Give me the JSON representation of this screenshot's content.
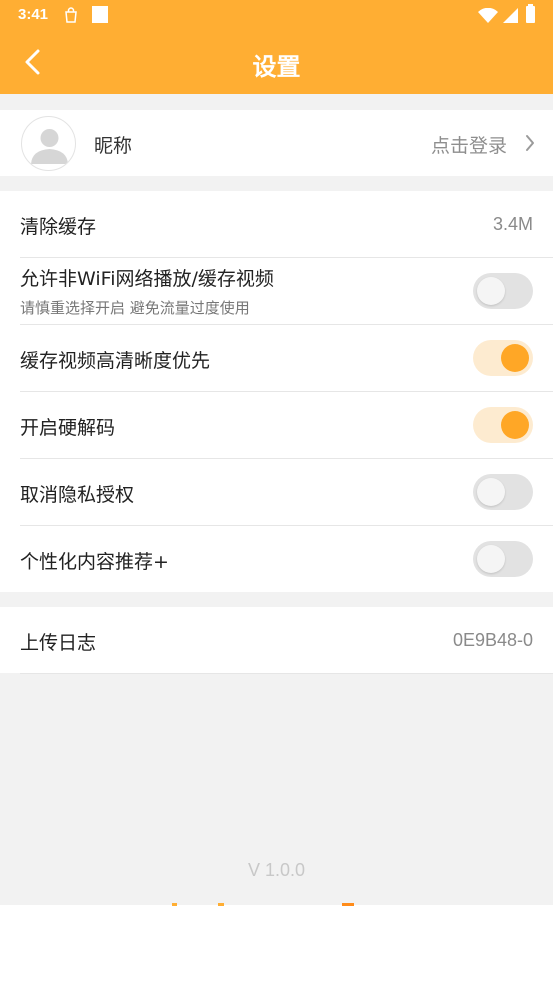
{
  "status_bar": {
    "time": "3:41"
  },
  "header": {
    "title": "设置"
  },
  "profile": {
    "nickname_label": "昵称",
    "login_label": "点击登录"
  },
  "settings": {
    "clear_cache": {
      "label": "清除缓存",
      "value": "3.4M"
    },
    "allow_non_wifi": {
      "label": "允许非WiFi网络播放/缓存视频",
      "sub": "请慎重选择开启 避免流量过度使用",
      "enabled": false
    },
    "hd_cache": {
      "label": "缓存视频高清晰度优先",
      "enabled": true
    },
    "hw_decode": {
      "label": "开启硬解码",
      "enabled": true
    },
    "revoke_privacy": {
      "label": "取消隐私授权",
      "enabled": false
    },
    "personalized": {
      "label": "个性化内容推荐+",
      "enabled": false
    }
  },
  "upload_log": {
    "label": "上传日志",
    "value": "0E9B48-0"
  },
  "footer": {
    "version": "V 1.0.0"
  },
  "colors": {
    "accent": "#ffae33",
    "toggle_on_knob": "#ffa726",
    "toggle_on_track": "#fdebd0",
    "toggle_off_track": "#e2e2e2"
  }
}
